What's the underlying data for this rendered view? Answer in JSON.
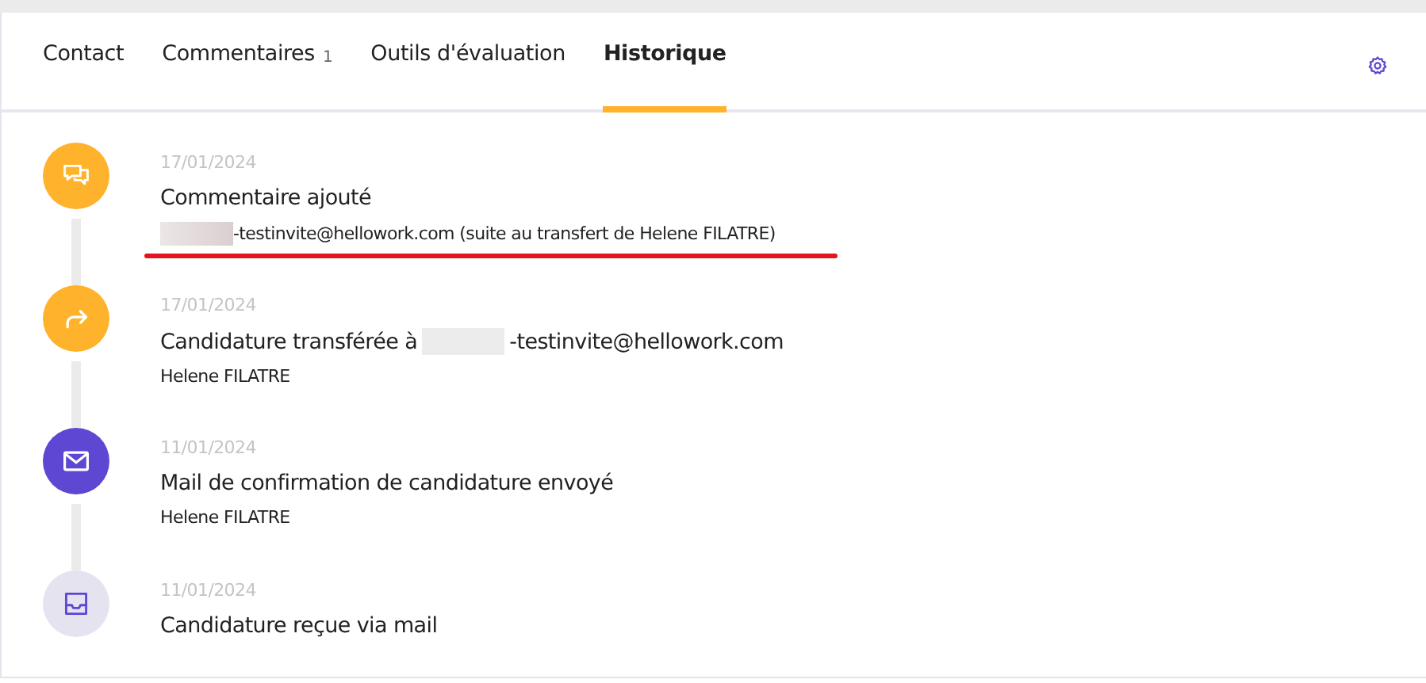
{
  "tabs": [
    {
      "label": "Contact",
      "selected": false
    },
    {
      "label": "Commentaires",
      "count": "1",
      "selected": false
    },
    {
      "label": "Outils d'évaluation",
      "selected": false
    },
    {
      "label": "Historique",
      "selected": true
    }
  ],
  "events": [
    {
      "kind": "comment",
      "date": "17/01/2024",
      "title": [
        {
          "text": "Commentaire ajouté"
        }
      ],
      "detail": [
        {
          "kind": "redacted"
        },
        {
          "kind": "text",
          "text": "-testinvite@hellowork.com (suite au transfert de Helene FILATRE)"
        }
      ],
      "underlined": true
    },
    {
      "kind": "forward",
      "date": "17/01/2024",
      "title": [
        {
          "text": "Candidature transférée à"
        },
        {
          "kind": "redacted"
        },
        {
          "text": "-testinvite@hellowork.com"
        }
      ],
      "detail": [
        {
          "kind": "text",
          "text": "Helene FILATRE"
        }
      ],
      "underlined": false
    },
    {
      "kind": "mail",
      "date": "11/01/2024",
      "title": [
        {
          "text": "Mail de confirmation de candidature envoyé"
        }
      ],
      "detail": [
        {
          "kind": "text",
          "text": "Helene FILATRE"
        }
      ],
      "underlined": false
    },
    {
      "kind": "inbox",
      "date": "11/01/2024",
      "title": [
        {
          "text": "Candidature reçue via mail"
        }
      ],
      "underlined": false
    }
  ]
}
